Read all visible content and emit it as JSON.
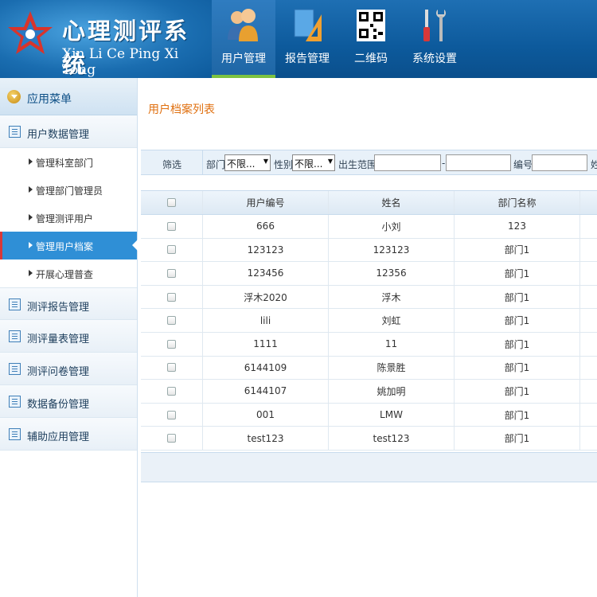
{
  "app": {
    "title": "心理测评系统",
    "subtitle": "Xin Li Ce Ping Xi Tong"
  },
  "topnav": [
    {
      "label": "用户管理",
      "icon": "users-icon",
      "active": true
    },
    {
      "label": "报告管理",
      "icon": "report-icon",
      "active": false
    },
    {
      "label": "二维码",
      "icon": "qrcode-icon",
      "active": false
    },
    {
      "label": "系统设置",
      "icon": "tools-icon",
      "active": false
    }
  ],
  "sidebar": {
    "header": "应用菜单",
    "groups": [
      {
        "label": "用户数据管理"
      },
      {
        "label": "测评报告管理"
      },
      {
        "label": "测评量表管理"
      },
      {
        "label": "测评问卷管理"
      },
      {
        "label": "数据备份管理"
      },
      {
        "label": "辅助应用管理"
      }
    ],
    "subitems": [
      {
        "label": "管理科室部门"
      },
      {
        "label": "管理部门管理员"
      },
      {
        "label": "管理测评用户"
      },
      {
        "label": "管理用户档案",
        "active": true
      },
      {
        "label": "开展心理普查"
      }
    ]
  },
  "main": {
    "title": "用户档案列表",
    "filter": {
      "label": "筛选",
      "dept_label": "部门",
      "dept_value": "不限...",
      "gender_label": "性别",
      "gender_value": "不限...",
      "birth_label": "出生范围",
      "dash": "-",
      "id_label": "编号",
      "cut_label": "姓"
    },
    "table": {
      "columns": [
        "用户编号",
        "姓名",
        "部门名称"
      ],
      "rows": [
        [
          "666",
          "小刘",
          "123"
        ],
        [
          "123123",
          "123123",
          "部门1"
        ],
        [
          "123456",
          "12356",
          "部门1"
        ],
        [
          "浮木2020",
          "浮木",
          "部门1"
        ],
        [
          "lili",
          "刘虹",
          "部门1"
        ],
        [
          "1111",
          "11",
          "部门1"
        ],
        [
          "6144109",
          "陈景胜",
          "部门1"
        ],
        [
          "6144107",
          "姚加明",
          "部门1"
        ],
        [
          "001",
          "LMW",
          "部门1"
        ],
        [
          "test123",
          "test123",
          "部门1"
        ]
      ]
    }
  },
  "colors": {
    "header_bg": "#0d5a9c",
    "active_tab_underline": "#7cc241",
    "sidebar_active": "#2f8fd6",
    "title_orange": "#e07010"
  }
}
